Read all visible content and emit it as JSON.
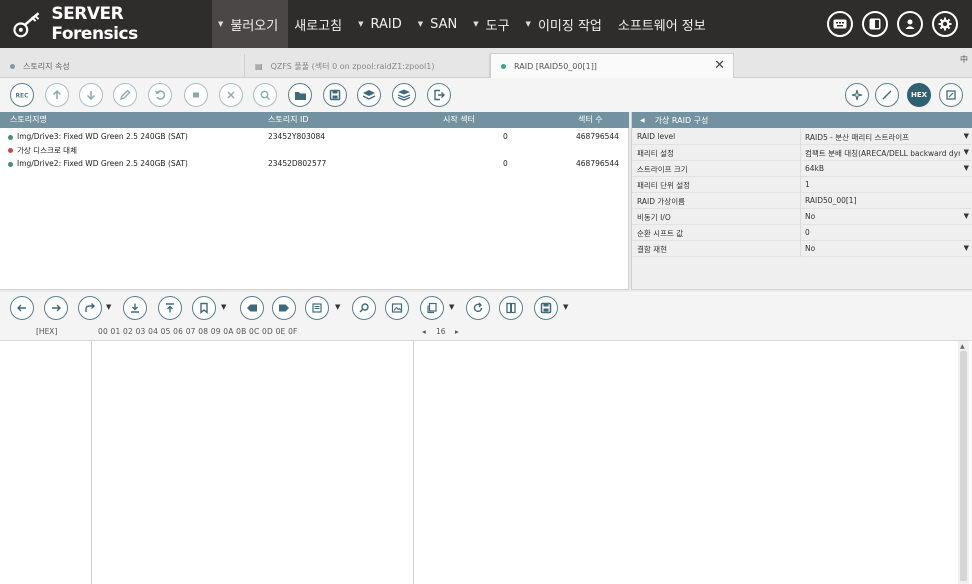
{
  "app": {
    "name": "SERVER Forensics"
  },
  "menu": [
    {
      "label": "불러오기",
      "active": true
    },
    {
      "label": "새로고침"
    },
    {
      "label": "RAID"
    },
    {
      "label": "SAN"
    },
    {
      "label": "도구"
    },
    {
      "label": "이미징 작업"
    },
    {
      "label": "소프트웨어 정보"
    }
  ],
  "tabs": [
    {
      "label": "스토리지 속성"
    },
    {
      "label": "QZFS 풀풀 (섹터 0 on zpool:raidZ1:zpool1)"
    },
    {
      "label": "RAID [RAID50_00[1]]"
    }
  ],
  "tab_close": "✕",
  "tab_pin": "中",
  "storage": {
    "headers": {
      "name": "스토리지명",
      "id": "스토리지 ID",
      "start": "시작 섹터",
      "count": "섹터 수"
    },
    "rows": [
      {
        "name": "Img/Drive3: Fixed WD Green 2.5 240GB (SAT)",
        "id": "23452Y803084",
        "start": "0",
        "count": "468796544",
        "dot": "#4a8a7a"
      },
      {
        "name": "가상 디스크로 대체",
        "id": "",
        "start": "",
        "count": "",
        "dot": "#c04a4a"
      },
      {
        "name": "Img/Drive2: Fixed WD Green 2.5 240GB (SAT)",
        "id": "23452D802577",
        "start": "0",
        "count": "468796544",
        "dot": "#4a8a7a"
      }
    ]
  },
  "raid_config": {
    "title": "가상 RAID 구성",
    "props": [
      {
        "key": "RAID level",
        "value": "RAID5 - 분산 패리티 스트라이프",
        "dropdown": true
      },
      {
        "key": "패리티 설정",
        "value": "컴팩트 분배 대칭(ARECA/DELL backward dynamic)",
        "dropdown": true
      },
      {
        "key": "스트라이프 크기",
        "value": "64kB",
        "dropdown": true
      },
      {
        "key": "패리티 단위 설정",
        "value": "1",
        "dropdown": false
      },
      {
        "key": "RAID 가상이름",
        "value": "RAID50_00[1]",
        "dropdown": false
      },
      {
        "key": "비동기 I/O",
        "value": "No",
        "dropdown": true
      },
      {
        "key": "순환 시프트 값",
        "value": "0",
        "dropdown": false
      },
      {
        "key": "결함 재현",
        "value": "No",
        "dropdown": true
      }
    ]
  },
  "hex": {
    "offset_label": "[HEX]",
    "columns": "00  01  02  03  04  05  06  07  08  09  0A  0B  0C  0D  0E  0F",
    "width_value": "16"
  },
  "icons": {
    "toolbar": [
      "rec-icon",
      "arrow-up-icon",
      "arrow-down-icon",
      "pen-icon",
      "undo-icon",
      "stop-icon",
      "cancel-icon",
      "search-icon",
      "folder-icon",
      "save-icon",
      "layers-icon",
      "stack-icon",
      "export-icon"
    ],
    "toolbar_right": [
      "sparkle-icon",
      "edit-line-icon",
      "hex-icon",
      "crop-icon"
    ],
    "hexbar": [
      "back-icon",
      "forward-icon",
      "jump-icon",
      "download-icon",
      "upload-icon",
      "bookmark-icon",
      "bookmark-left-icon",
      "bookmark-right-icon",
      "list-icon",
      "find-icon",
      "image-icon",
      "copy-icon",
      "refresh-icon",
      "panel-icon",
      "save-icon"
    ]
  },
  "colors": {
    "header_bg": "#2f2c2c",
    "grid_head": "#7391a1",
    "accent": "#3f6a7c"
  }
}
